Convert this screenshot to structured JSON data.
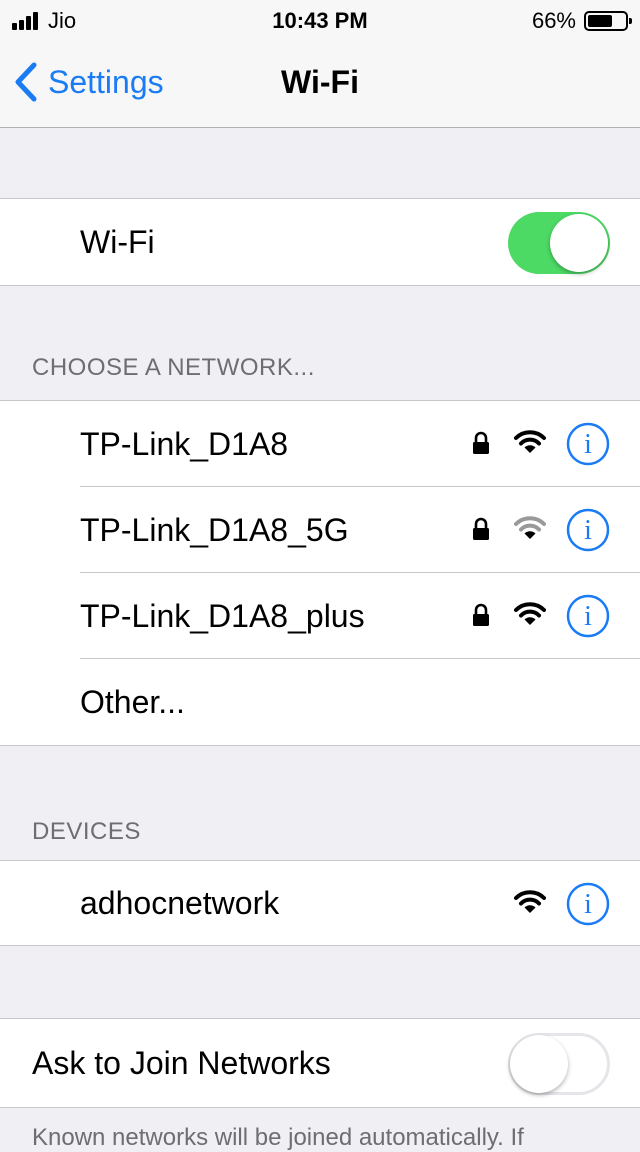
{
  "status_bar": {
    "carrier": "Jio",
    "time": "10:43 PM",
    "battery_percent_label": "66%",
    "battery_level": 0.66
  },
  "nav": {
    "back_label": "Settings",
    "title": "Wi-Fi"
  },
  "wifi_toggle": {
    "label": "Wi-Fi",
    "state": "on"
  },
  "networks_section": {
    "header": "CHOOSE A NETWORK...",
    "items": [
      {
        "name": "TP-Link_D1A8",
        "secured": true,
        "signal": "full"
      },
      {
        "name": "TP-Link_D1A8_5G",
        "secured": true,
        "signal": "weak"
      },
      {
        "name": "TP-Link_D1A8_plus",
        "secured": true,
        "signal": "full"
      }
    ],
    "other_label": "Other..."
  },
  "devices_section": {
    "header": "DEVICES",
    "items": [
      {
        "name": "adhocnetwork",
        "signal": "full"
      }
    ]
  },
  "ask_to_join": {
    "label": "Ask to Join Networks",
    "state": "off"
  },
  "footer_note": "Known networks will be joined automatically. If",
  "colors": {
    "accent": "#1a7cf5",
    "toggle_on": "#4cd964",
    "background": "#efeff4",
    "weak_signal": "#999999"
  },
  "icons": [
    "signal-icon",
    "battery-icon",
    "chevron-left-icon",
    "lock-icon",
    "wifi-icon",
    "info-icon"
  ]
}
